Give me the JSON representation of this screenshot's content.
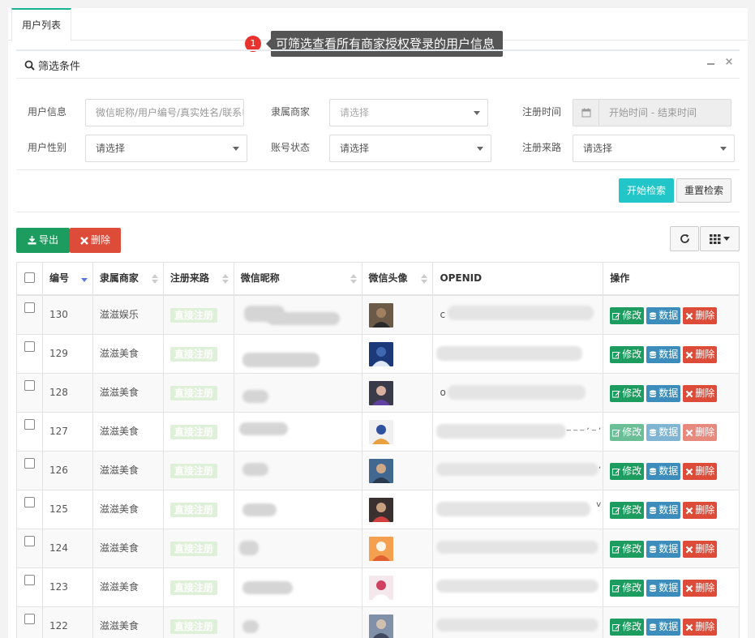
{
  "tabs": [
    {
      "label": "用户列表"
    }
  ],
  "tooltip": {
    "number": "1",
    "text": "可筛选查看所有商家授权登录的用户信息"
  },
  "filter": {
    "title": "筛选条件",
    "fields": {
      "user_info": {
        "label": "用户信息",
        "placeholder": "微信昵称/用户编号/真实姓名/联系电话"
      },
      "merchant": {
        "label": "隶属商家",
        "value": "请选择"
      },
      "reg_time": {
        "label": "注册时间",
        "placeholder": "开始时间 - 结束时间"
      },
      "gender": {
        "label": "用户性别",
        "value": "请选择"
      },
      "status": {
        "label": "账号状态",
        "value": "请选择"
      },
      "source": {
        "label": "注册来路",
        "value": "请选择"
      }
    },
    "search_label": "开始检索",
    "reset_label": "重置检索"
  },
  "toolbar": {
    "export_label": "导出",
    "delete_label": "删除"
  },
  "table": {
    "headers": [
      "编号",
      "隶属商家",
      "注册来路",
      "微信昵称",
      "微信头像",
      "OPENID",
      "操作"
    ],
    "row_actions": {
      "edit": "修改",
      "data": "数据",
      "delete": "删除"
    },
    "rows": [
      {
        "id": "130",
        "merchant": "滋滋娱乐",
        "source": "直接注册",
        "openid_hint": "c",
        "openid_tail": ""
      },
      {
        "id": "129",
        "merchant": "滋滋美食",
        "source": "直接注册",
        "openid_hint": "",
        "openid_tail": ""
      },
      {
        "id": "128",
        "merchant": "滋滋美食",
        "source": "直接注册",
        "openid_hint": "o",
        "openid_tail": ""
      },
      {
        "id": "127",
        "merchant": "滋滋美食",
        "source": "直接注册",
        "openid_hint": "",
        "openid_tail": "_ _ _ , _ ,"
      },
      {
        "id": "126",
        "merchant": "滋滋美食",
        "source": "直接注册",
        "openid_hint": "",
        "openid_tail": ","
      },
      {
        "id": "125",
        "merchant": "滋滋美食",
        "source": "直接注册",
        "openid_hint": "",
        "openid_tail": "v"
      },
      {
        "id": "124",
        "merchant": "滋滋美食",
        "source": "直接注册",
        "openid_hint": "",
        "openid_tail": ""
      },
      {
        "id": "123",
        "merchant": "滋滋美食",
        "source": "直接注册",
        "openid_hint": "",
        "openid_tail": ""
      },
      {
        "id": "122",
        "merchant": "滋滋美食",
        "source": "直接注册",
        "openid_hint": "",
        "openid_tail": ""
      }
    ]
  },
  "colors": {
    "accent": "#1ab394",
    "info": "#23c6c8",
    "success": "#1c9d5f",
    "primary": "#3c8dbc",
    "danger": "#dd4b39"
  }
}
